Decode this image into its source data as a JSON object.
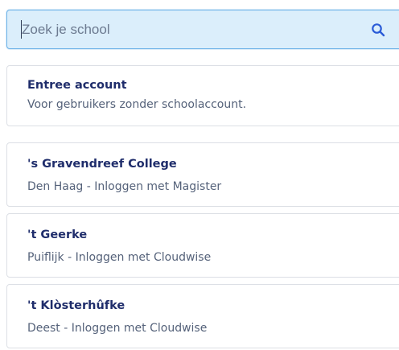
{
  "search": {
    "placeholder": "Zoek je school",
    "value": ""
  },
  "entree": {
    "title": "Entree account",
    "subtitle": "Voor gebruikers zonder schoolaccount."
  },
  "schools": [
    {
      "name": "'s Gravendreef College",
      "detail": "Den Haag - Inloggen met Magister"
    },
    {
      "name": "'t Geerke",
      "detail": "Puiflijk - Inloggen met Cloudwise"
    },
    {
      "name": "'t Klòsterhûfke",
      "detail": "Deest - Inloggen met Cloudwise"
    }
  ],
  "colors": {
    "search_bg": "#dbeefb",
    "search_border": "#6fb3e8",
    "title_text": "#1f2d6b",
    "sub_text": "#55627a",
    "icon": "#2a5bd7"
  }
}
